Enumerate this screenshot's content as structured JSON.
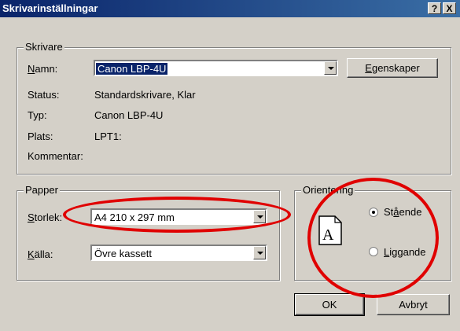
{
  "window": {
    "title": "Skrivarinställningar",
    "help_btn": "?",
    "close_btn": "X"
  },
  "printer": {
    "legend": "Skrivare",
    "name_label_u": "N",
    "name_label_rest": "amn:",
    "name_value": "Canon LBP-4U",
    "properties_u": "E",
    "properties_rest": "genskaper",
    "status_label": "Status:",
    "status_value": "Standardskrivare, Klar",
    "type_label": "Typ:",
    "type_value": "Canon LBP-4U",
    "location_label": "Plats:",
    "location_value": "LPT1:",
    "comment_label": "Kommentar:"
  },
  "paper": {
    "legend": "Papper",
    "size_label_u": "S",
    "size_label_rest": "torlek:",
    "size_value": "A4 210 x 297 mm",
    "source_label_u": "K",
    "source_label_rest": "älla:",
    "source_value": "Övre kassett"
  },
  "orientation": {
    "legend": "Orientering",
    "icon_letter": "A",
    "portrait_pre": "St",
    "portrait_u": "å",
    "portrait_post": "ende",
    "landscape_u": "L",
    "landscape_rest": "iggande",
    "selected": "portrait"
  },
  "buttons": {
    "ok": "OK",
    "cancel": "Avbryt"
  },
  "colors": {
    "annotation": "#e00000",
    "titlebar": "#0a246a"
  }
}
